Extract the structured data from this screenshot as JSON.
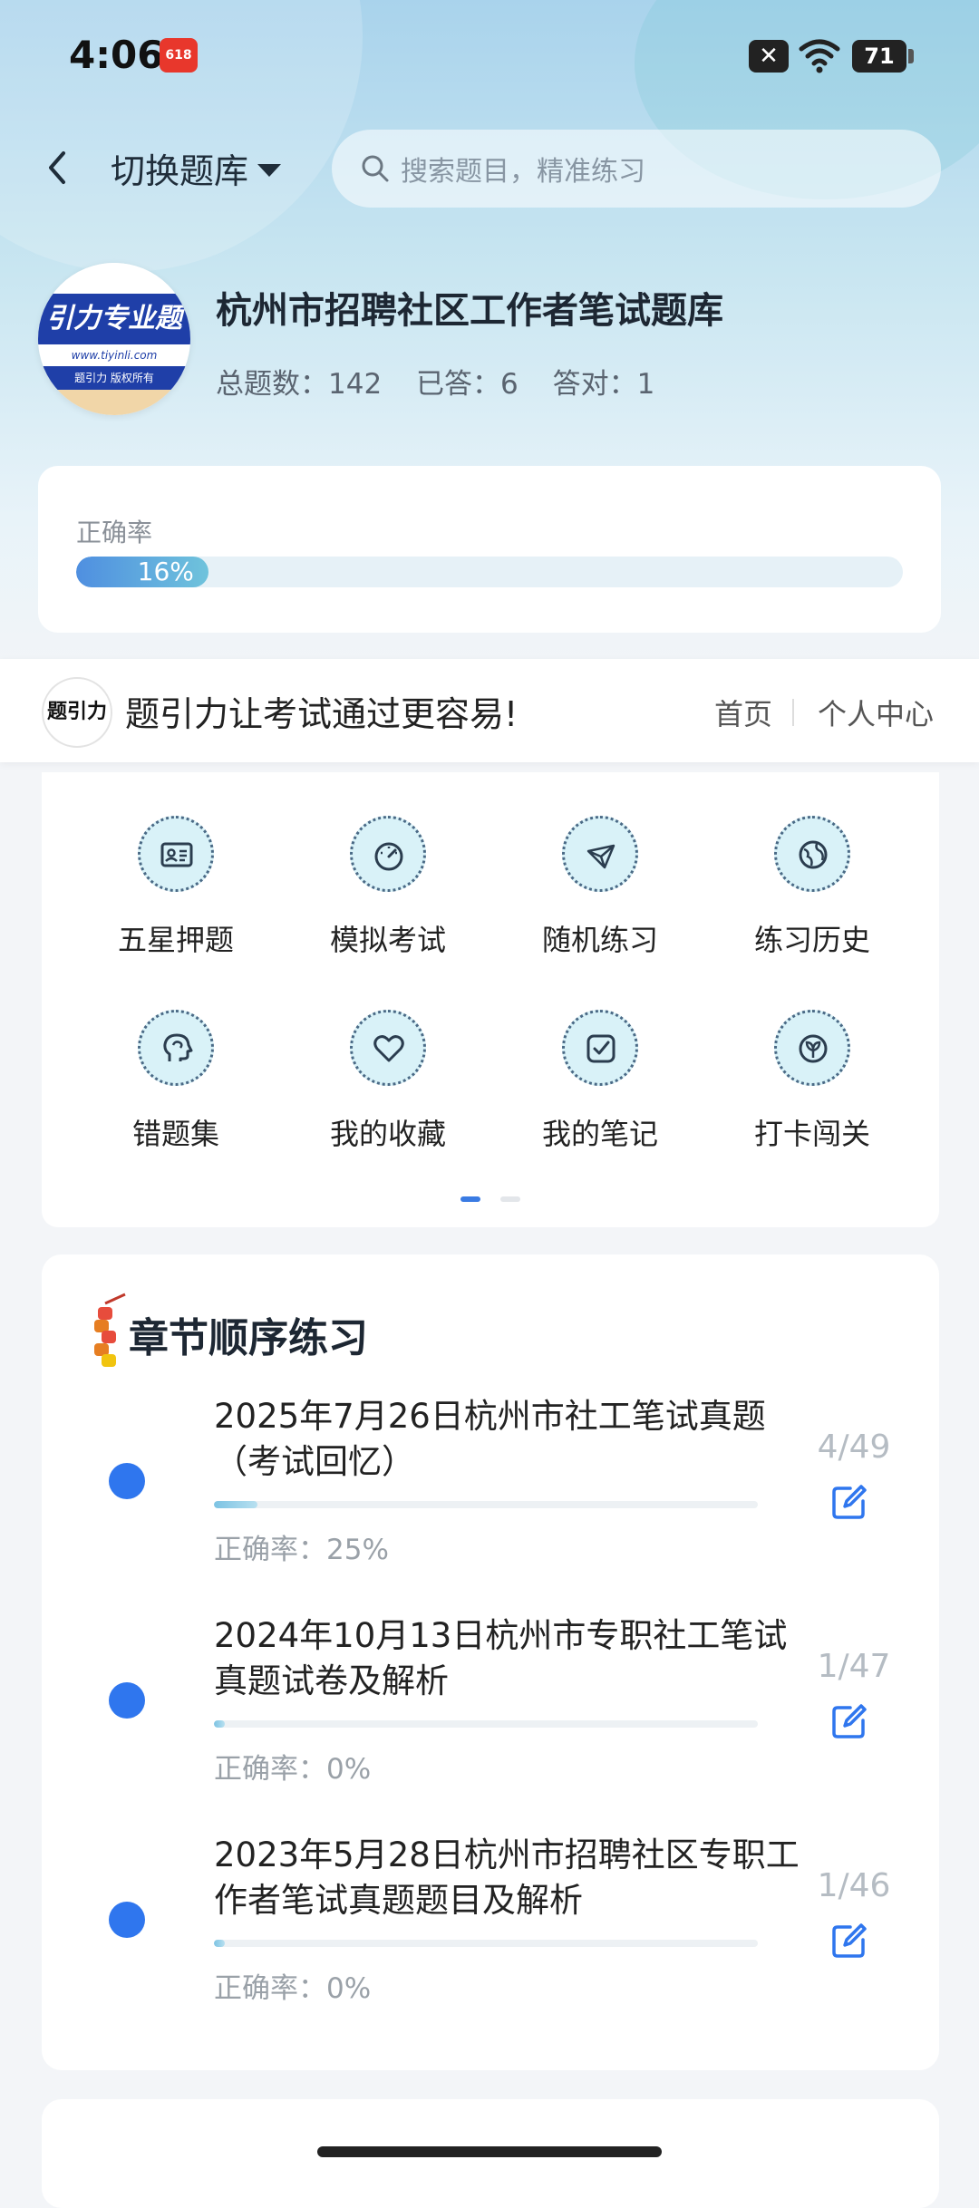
{
  "status_bar": {
    "time": "4:06",
    "app_badge": "618",
    "battery": "71"
  },
  "top_bar": {
    "switch_label": "切换题库",
    "search_placeholder": "搜索题目，精准练习"
  },
  "bank": {
    "logo_text": "引力专业题",
    "logo_url": "www.tiyinli.com",
    "logo_copyright": "题引力 版权所有",
    "title": "杭州市招聘社区工作者笔试题库",
    "stats": {
      "total_label": "总题数：142",
      "answered_label": "已答：6",
      "correct_label": "答对：1"
    }
  },
  "accuracy": {
    "label": "正确率",
    "value_text": "16%",
    "value": 0.16
  },
  "promo": {
    "logo_text": "题引力",
    "slogan": "题引力让考试通过更容易!",
    "home": "首页",
    "personal_center": "个人中心"
  },
  "features": [
    {
      "label": "五星押题",
      "icon": "id-card-icon"
    },
    {
      "label": "模拟考试",
      "icon": "speedometer-icon"
    },
    {
      "label": "随机练习",
      "icon": "network-icon"
    },
    {
      "label": "练习历史",
      "icon": "globe-icon"
    },
    {
      "label": "错题集",
      "icon": "head-brain-icon"
    },
    {
      "label": "我的收藏",
      "icon": "heart-icon"
    },
    {
      "label": "我的笔记",
      "icon": "note-check-icon"
    },
    {
      "label": "打卡闯关",
      "icon": "leaf-badge-icon"
    }
  ],
  "chapters": {
    "title": "章节顺序练习",
    "items": [
      {
        "name": "2025年7月26日杭州市社工笔试真题（考试回忆）",
        "count": "4/49",
        "progress": 0.08,
        "accuracy": "正确率：25%"
      },
      {
        "name": "2024年10月13日杭州市专职社工笔试真题试卷及解析",
        "count": "1/47",
        "progress": 0.02,
        "accuracy": "正确率：0%"
      },
      {
        "name": "2023年5月28日杭州市招聘社区专职工作者笔试真题题目及解析",
        "count": "1/46",
        "progress": 0.02,
        "accuracy": "正确率：0%"
      }
    ]
  },
  "colors": {
    "accent": "#2f76ee",
    "progress_start": "#4f8fe0",
    "progress_end": "#6fc3dc"
  }
}
